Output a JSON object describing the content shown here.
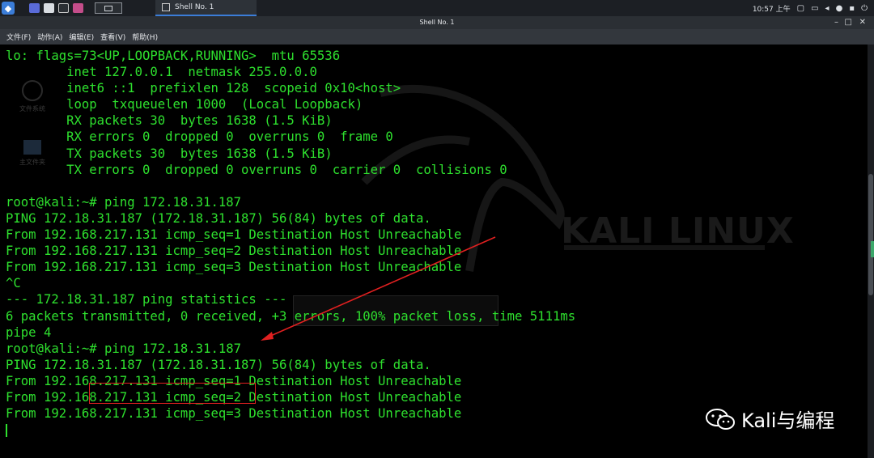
{
  "taskbar": {
    "task_title": "Shell No. 1",
    "clock": "10:57 上午"
  },
  "window": {
    "title": "Shell No. 1"
  },
  "menu": {
    "items": [
      "文件(F)",
      "动作(A)",
      "编辑(E)",
      "查看(V)",
      "帮助(H)"
    ]
  },
  "desktop": {
    "icon1_label": "文件系统",
    "icon2_label": "主文件夹",
    "logo_text": "KALI LINUX"
  },
  "terminal": {
    "lines": [
      "lo: flags=73<UP,LOOPBACK,RUNNING>  mtu 65536",
      "        inet 127.0.0.1  netmask 255.0.0.0",
      "        inet6 ::1  prefixlen 128  scopeid 0x10<host>",
      "        loop  txqueuelen 1000  (Local Loopback)",
      "        RX packets 30  bytes 1638 (1.5 KiB)",
      "        RX errors 0  dropped 0  overruns 0  frame 0",
      "        TX packets 30  bytes 1638 (1.5 KiB)",
      "        TX errors 0  dropped 0 overruns 0  carrier 0  collisions 0",
      "",
      "root@kali:~# ping 172.18.31.187",
      "PING 172.18.31.187 (172.18.31.187) 56(84) bytes of data.",
      "From 192.168.217.131 icmp_seq=1 Destination Host Unreachable",
      "From 192.168.217.131 icmp_seq=2 Destination Host Unreachable",
      "From 192.168.217.131 icmp_seq=3 Destination Host Unreachable",
      "^C",
      "--- 172.18.31.187 ping statistics ---",
      "6 packets transmitted, 0 received, +3 errors, 100% packet loss, time 5111ms",
      "pipe 4",
      "root@kali:~# ping 172.18.31.187",
      "PING 172.18.31.187 (172.18.31.187) 56(84) bytes of data.",
      "From 192.168.217.131 icmp_seq=1 Destination Host Unreachable",
      "From 192.168.217.131 icmp_seq=2 Destination Host Unreachable",
      "From 192.168.217.131 icmp_seq=3 Destination Host Unreachable"
    ]
  },
  "watermark": {
    "text": "Kali与编程"
  },
  "colors": {
    "terminal_text": "#2ee02e",
    "annotation": "#e02020",
    "panel_bg": "#1c1f24"
  }
}
